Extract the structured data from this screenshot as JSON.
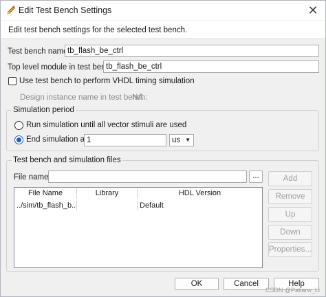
{
  "window": {
    "title": "Edit Test Bench Settings",
    "close_glyph": "✕"
  },
  "header": {
    "description": "Edit test bench settings for the selected test bench."
  },
  "form": {
    "tb_name_label": "Test bench name:",
    "tb_name_value": "tb_flash_be_ctrl",
    "top_module_label": "Top level module in test bench:",
    "top_module_value": "tb_flash_be_ctrl",
    "vhdl_timing_label": "Use test bench to perform VHDL timing simulation",
    "vhdl_timing_checked": false,
    "design_instance_label": "Design instance name in test bench:",
    "design_instance_value": "NA"
  },
  "simulation": {
    "group_title": "Simulation period",
    "run_all_label": "Run simulation until all vector stimuli are used",
    "end_at_label": "End simulation at:",
    "end_at_value": "1",
    "unit_value": "us",
    "selected": "end_at"
  },
  "files": {
    "group_title": "Test bench and simulation files",
    "file_name_label": "File name:",
    "file_name_value": "",
    "browse_label": "...",
    "columns": [
      "File Name",
      "Library",
      "HDL Version"
    ],
    "rows": [
      {
        "file": "../sim/tb_flash_b...",
        "library": "",
        "hdl": "Default"
      }
    ],
    "buttons": {
      "add": "Add",
      "remove": "Remove",
      "up": "Up",
      "down": "Down",
      "properties": "Properties..."
    }
  },
  "footer": {
    "ok": "OK",
    "cancel": "Cancel",
    "help": "Help",
    "watermark": "CSDN @Patiarw_Li"
  },
  "colors": {
    "accent": "#1f5fbf",
    "dialog_bg": "#f0f0f0"
  },
  "icons": {
    "title": "pencil-icon",
    "close": "close-icon",
    "dropdown": "chevron-down-icon"
  }
}
